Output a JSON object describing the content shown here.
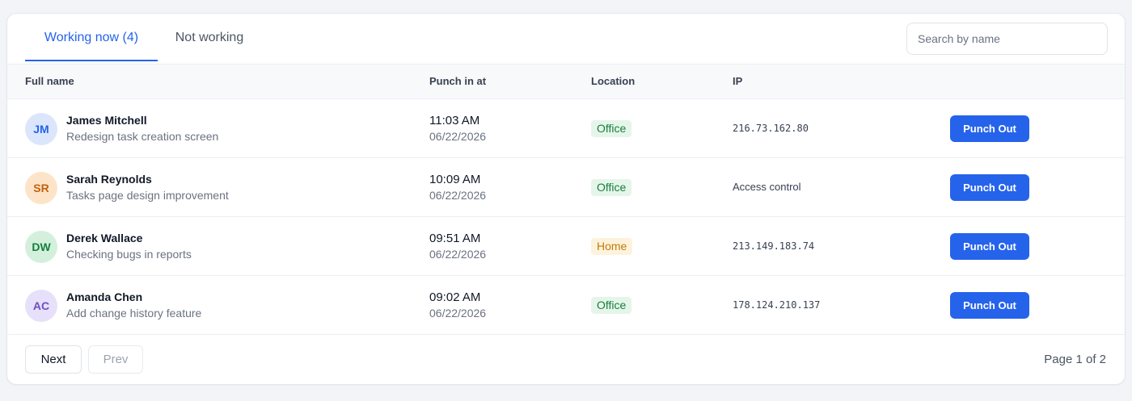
{
  "tabs": [
    {
      "label": "Working now (4)",
      "active": true
    },
    {
      "label": "Not working",
      "active": false
    }
  ],
  "search": {
    "placeholder": "Search by name",
    "value": ""
  },
  "columns": {
    "full_name": "Full name",
    "punch_in": "Punch in at",
    "location": "Location",
    "ip": "IP"
  },
  "rows": [
    {
      "initials": "JM",
      "avatar_bg": "#dbe6fc",
      "avatar_fg": "#2563eb",
      "name": "James Mitchell",
      "task": "Redesign task creation screen",
      "time": "11:03 AM",
      "date": "06/22/2026",
      "location": "Office",
      "loc_bg": "#e6f5ea",
      "loc_fg": "#15803d",
      "ip": "216.73.162.80",
      "ip_mono": true,
      "action": "Punch Out"
    },
    {
      "initials": "SR",
      "avatar_bg": "#fde4c8",
      "avatar_fg": "#c2620f",
      "name": "Sarah Reynolds",
      "task": "Tasks page design improvement",
      "time": "10:09 AM",
      "date": "06/22/2026",
      "location": "Office",
      "loc_bg": "#e6f5ea",
      "loc_fg": "#15803d",
      "ip": "Access control",
      "ip_mono": false,
      "action": "Punch Out"
    },
    {
      "initials": "DW",
      "avatar_bg": "#d4f0dc",
      "avatar_fg": "#15803d",
      "name": "Derek Wallace",
      "task": "Checking bugs in reports",
      "time": "09:51 AM",
      "date": "06/22/2026",
      "location": "Home",
      "loc_bg": "#fdf3dc",
      "loc_fg": "#c27a0e",
      "ip": "213.149.183.74",
      "ip_mono": true,
      "action": "Punch Out"
    },
    {
      "initials": "AC",
      "avatar_bg": "#e6e0fa",
      "avatar_fg": "#6d4fc2",
      "name": "Amanda Chen",
      "task": "Add change history feature",
      "time": "09:02 AM",
      "date": "06/22/2026",
      "location": "Office",
      "loc_bg": "#e6f5ea",
      "loc_fg": "#15803d",
      "ip": "178.124.210.137",
      "ip_mono": true,
      "action": "Punch Out"
    }
  ],
  "pagination": {
    "next_label": "Next",
    "prev_label": "Prev",
    "page_info": "Page 1 of 2"
  },
  "colors": {
    "accent": "#2563eb",
    "background": "#f3f4f8"
  }
}
